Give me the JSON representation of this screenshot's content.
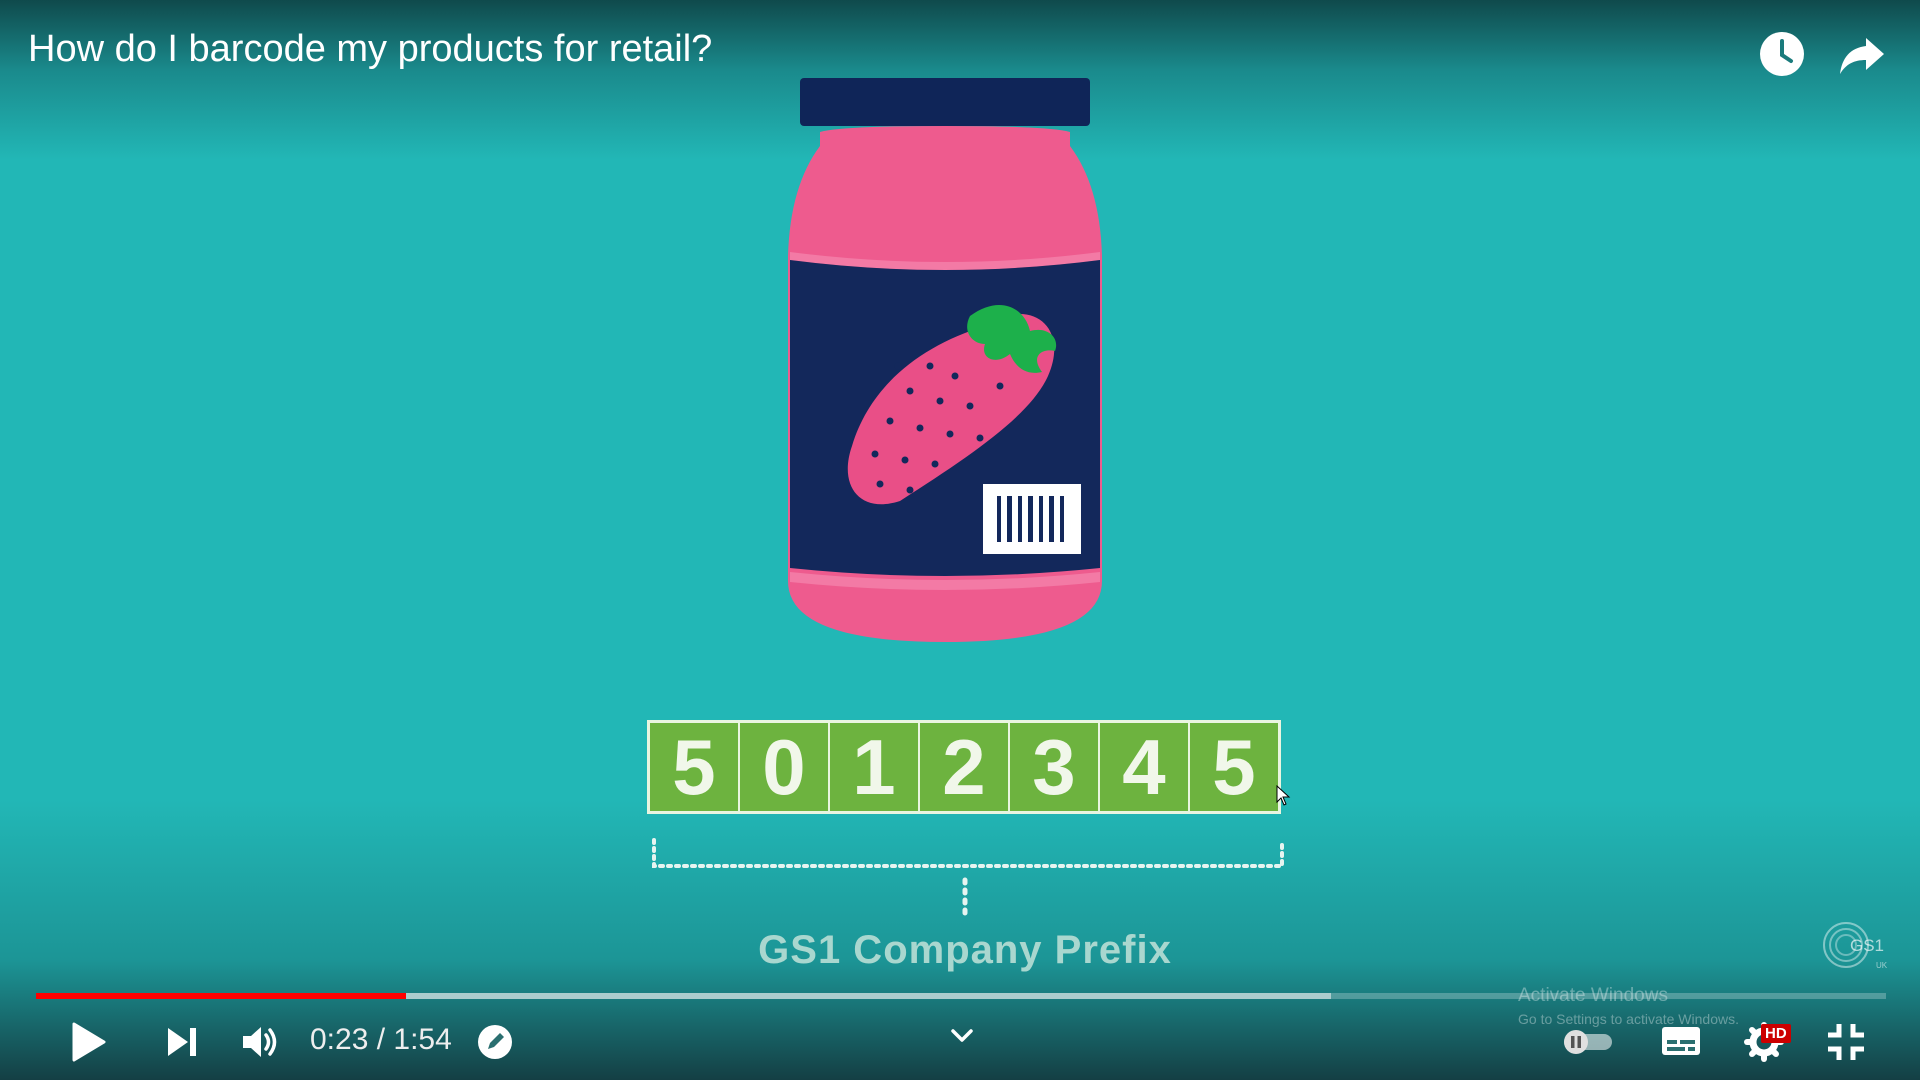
{
  "video": {
    "title": "How do I barcode my products for retail?"
  },
  "top_actions": {
    "watch_later_icon": "clock-icon",
    "share_icon": "share-arrow-icon"
  },
  "scene": {
    "digits": [
      "5",
      "0",
      "1",
      "2",
      "3",
      "4",
      "5"
    ],
    "prefix_label": "GS1 Company Prefix",
    "logo_text": "GS1",
    "logo_sub": "UK"
  },
  "player": {
    "time": "0:23 / 1:54",
    "progress_played": 0.2,
    "progress_buffered": 0.7,
    "colors": {
      "progress": "#ff0000",
      "accent": "#cc0000"
    }
  },
  "watermark": {
    "line1": "Activate Windows",
    "line2": "Go to Settings to activate Windows."
  },
  "controls": {
    "hd_badge": "HD"
  }
}
